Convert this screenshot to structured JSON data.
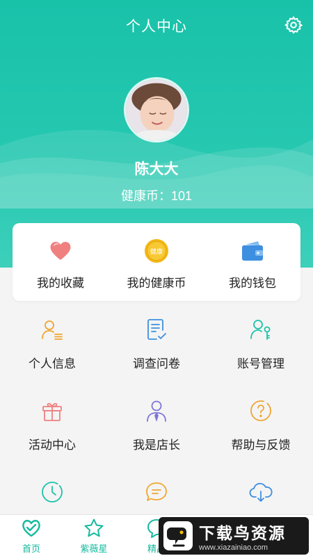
{
  "header": {
    "title": "个人中心",
    "username": "陈大大",
    "coins_text": "健康币：101"
  },
  "quick_card": [
    {
      "label": "我的收藏",
      "icon": "heart-icon"
    },
    {
      "label": "我的健康币",
      "icon": "coin-icon",
      "icon_text": "健康"
    },
    {
      "label": "我的钱包",
      "icon": "wallet-icon"
    }
  ],
  "menu": [
    {
      "label": "个人信息",
      "icon": "user-info-icon"
    },
    {
      "label": "调查问卷",
      "icon": "survey-icon"
    },
    {
      "label": "账号管理",
      "icon": "account-key-icon"
    },
    {
      "label": "活动中心",
      "icon": "gift-icon"
    },
    {
      "label": "我是店长",
      "icon": "manager-icon"
    },
    {
      "label": "帮助与反馈",
      "icon": "help-icon"
    },
    {
      "label": "",
      "icon": "clock-icon"
    },
    {
      "label": "",
      "icon": "message-icon"
    },
    {
      "label": "",
      "icon": "cloud-download-icon"
    }
  ],
  "tabbar": [
    {
      "label": "首页",
      "icon": "home-heart-icon"
    },
    {
      "label": "紫薇星",
      "icon": "star-icon"
    },
    {
      "label": "精品",
      "icon": "chat-icon"
    }
  ],
  "watermark": {
    "title": "下载鸟资源",
    "url": "www.xiazainiao.com"
  },
  "colors": {
    "primary": "#1bc3aa",
    "orange": "#f0a530",
    "purple": "#7c74d8",
    "pink": "#f08080",
    "blue": "#3d8fe0"
  }
}
